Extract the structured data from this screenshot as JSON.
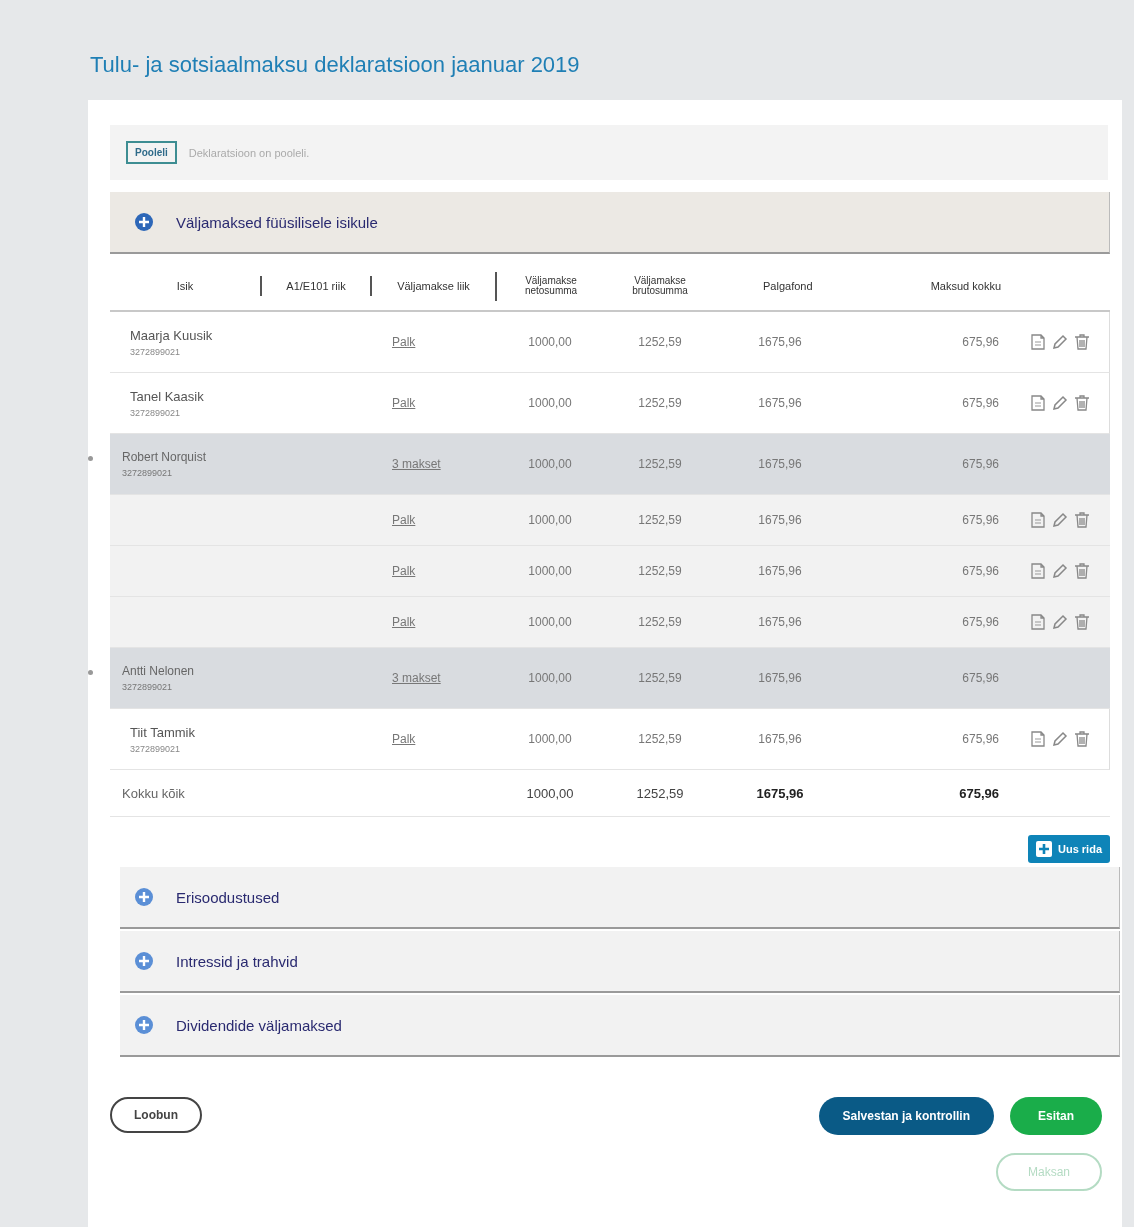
{
  "title": "Tulu- ja sotsiaalmaksu deklaratsioon jaanuar 2019",
  "status": {
    "badge": "Pooleli",
    "text": "Deklaratsioon on pooleli."
  },
  "main_section": {
    "title": "Väljamaksed füüsilisele isikule",
    "expanded": true
  },
  "table": {
    "columns": [
      "Isik",
      "A1/E101 riik",
      "Väljamakse liik",
      "Väljamakse netosumma",
      "Väljamakse brutosumma",
      "Palgafond",
      "Maksud kokku"
    ],
    "rows": [
      {
        "kind": "person",
        "name": "Maarja Kuusik",
        "code": "3272899021",
        "type": "Palk",
        "neto": "1000,00",
        "bruto": "1252,59",
        "palgafond": "1675,96",
        "maksud": "675,96",
        "actions": true
      },
      {
        "kind": "person",
        "name": "Tanel Kaasik",
        "code": "3272899021",
        "type": "Palk",
        "neto": "1000,00",
        "bruto": "1252,59",
        "palgafond": "1675,96",
        "maksud": "675,96",
        "actions": true
      },
      {
        "kind": "group",
        "name": "Robert Norquist",
        "code": "3272899021",
        "type": "3 makset",
        "neto": "1000,00",
        "bruto": "1252,59",
        "palgafond": "1675,96",
        "maksud": "675,96",
        "actions": false
      },
      {
        "kind": "sub",
        "type": "Palk",
        "neto": "1000,00",
        "bruto": "1252,59",
        "palgafond": "1675,96",
        "maksud": "675,96",
        "actions": true
      },
      {
        "kind": "sub",
        "type": "Palk",
        "neto": "1000,00",
        "bruto": "1252,59",
        "palgafond": "1675,96",
        "maksud": "675,96",
        "actions": true
      },
      {
        "kind": "sub",
        "type": "Palk",
        "neto": "1000,00",
        "bruto": "1252,59",
        "palgafond": "1675,96",
        "maksud": "675,96",
        "actions": true
      },
      {
        "kind": "group",
        "name": "Antti Nelonen",
        "code": "3272899021",
        "type": "3 makset",
        "neto": "1000,00",
        "bruto": "1252,59",
        "palgafond": "1675,96",
        "maksud": "675,96",
        "actions": false
      },
      {
        "kind": "person",
        "name": "Tiit Tammik",
        "code": "3272899021",
        "type": "Palk",
        "neto": "1000,00",
        "bruto": "1252,59",
        "palgafond": "1675,96",
        "maksud": "675,96",
        "actions": true
      }
    ],
    "total": {
      "label": "Kokku kõik",
      "neto": "1000,00",
      "bruto": "1252,59",
      "palgafond": "1675,96",
      "maksud": "675,96"
    }
  },
  "add_row_button": "Uus rida",
  "sections": [
    {
      "title": "Erisoodustused",
      "expanded": false
    },
    {
      "title": "Intressid ja trahvid",
      "expanded": false
    },
    {
      "title": "Dividendide väljamaksed",
      "expanded": false
    }
  ],
  "buttons": [
    {
      "kind": "cancel",
      "label": "Loobun",
      "disabled": false
    },
    {
      "kind": "save",
      "label": "Salvestan ja kontrollin",
      "disabled": false
    },
    {
      "kind": "submit",
      "label": "Esitan",
      "disabled": false
    },
    {
      "kind": "pay",
      "label": "Maksan",
      "disabled": true
    }
  ]
}
